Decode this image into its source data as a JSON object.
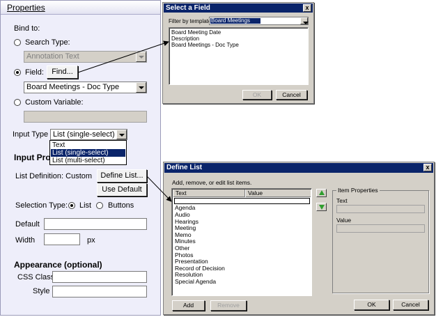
{
  "properties": {
    "title": "Properties",
    "bind_to_label": "Bind to:",
    "search_type_label": "Search Type:",
    "search_type_value": "Annotation Text",
    "field_label": "Field:",
    "find_button": "Find...",
    "field_value": "Board Meetings - Doc Type",
    "custom_variable_label": "Custom Variable:",
    "custom_variable_value": "",
    "input_type_label": "Input Type",
    "input_type_value": "List (single-select)",
    "input_type_options": [
      "Text",
      "List (single-select)",
      "List (multi-select)"
    ],
    "input_type_selected_index": 1,
    "input_properties_heading": "Input Prop",
    "list_definition_label": "List Definition: Custom",
    "define_list_button": "Define List...",
    "use_default_button": "Use Default",
    "selection_type_label": "Selection Type:",
    "selection_list_label": "List",
    "selection_buttons_label": "Buttons",
    "selection_type_value": "List",
    "default_label": "Default",
    "default_value": "",
    "width_label": "Width",
    "width_value": "",
    "width_unit": "px",
    "appearance_heading": "Appearance (optional)",
    "css_class_label": "CSS Class",
    "css_class_value": "",
    "style_label": "Style",
    "style_value": ""
  },
  "select_field_dialog": {
    "title": "Select a Field",
    "close_glyph": "x",
    "filter_label": "Filter by template",
    "filter_value": "Board Meetings",
    "fields": [
      "Board Meeting Date",
      "Description",
      "Board Meetings - Doc Type"
    ],
    "ok_button": "OK",
    "cancel_button": "Cancel",
    "ok_disabled": true
  },
  "define_list_dialog": {
    "title": "Define List",
    "close_glyph": "x",
    "instruction": "Add, remove, or edit list items.",
    "columns": [
      "Text",
      "Value"
    ],
    "items": [
      "",
      "Agenda",
      "Audio",
      "Hearings",
      "Meeting",
      "Memo",
      "Minutes",
      "Other",
      "Photos",
      "Presentation",
      "Record of Decision",
      "Resolution",
      "Special Agenda"
    ],
    "item_properties_heading": "Item Properties",
    "text_label": "Text",
    "text_value": "",
    "value_label": "Value",
    "value_value": "",
    "add_button": "Add",
    "remove_button": "Remove",
    "ok_button": "OK",
    "cancel_button": "Cancel",
    "remove_disabled": true,
    "move_up_icon": "green-up-arrow",
    "move_down_icon": "green-down-arrow"
  },
  "colors": {
    "panel_bg": "#eeeefa",
    "dialog_bg": "#d4d0c8",
    "titlebar": "#0a246a",
    "selection": "#0a246a",
    "arrow_green": "#2e9e2e"
  }
}
